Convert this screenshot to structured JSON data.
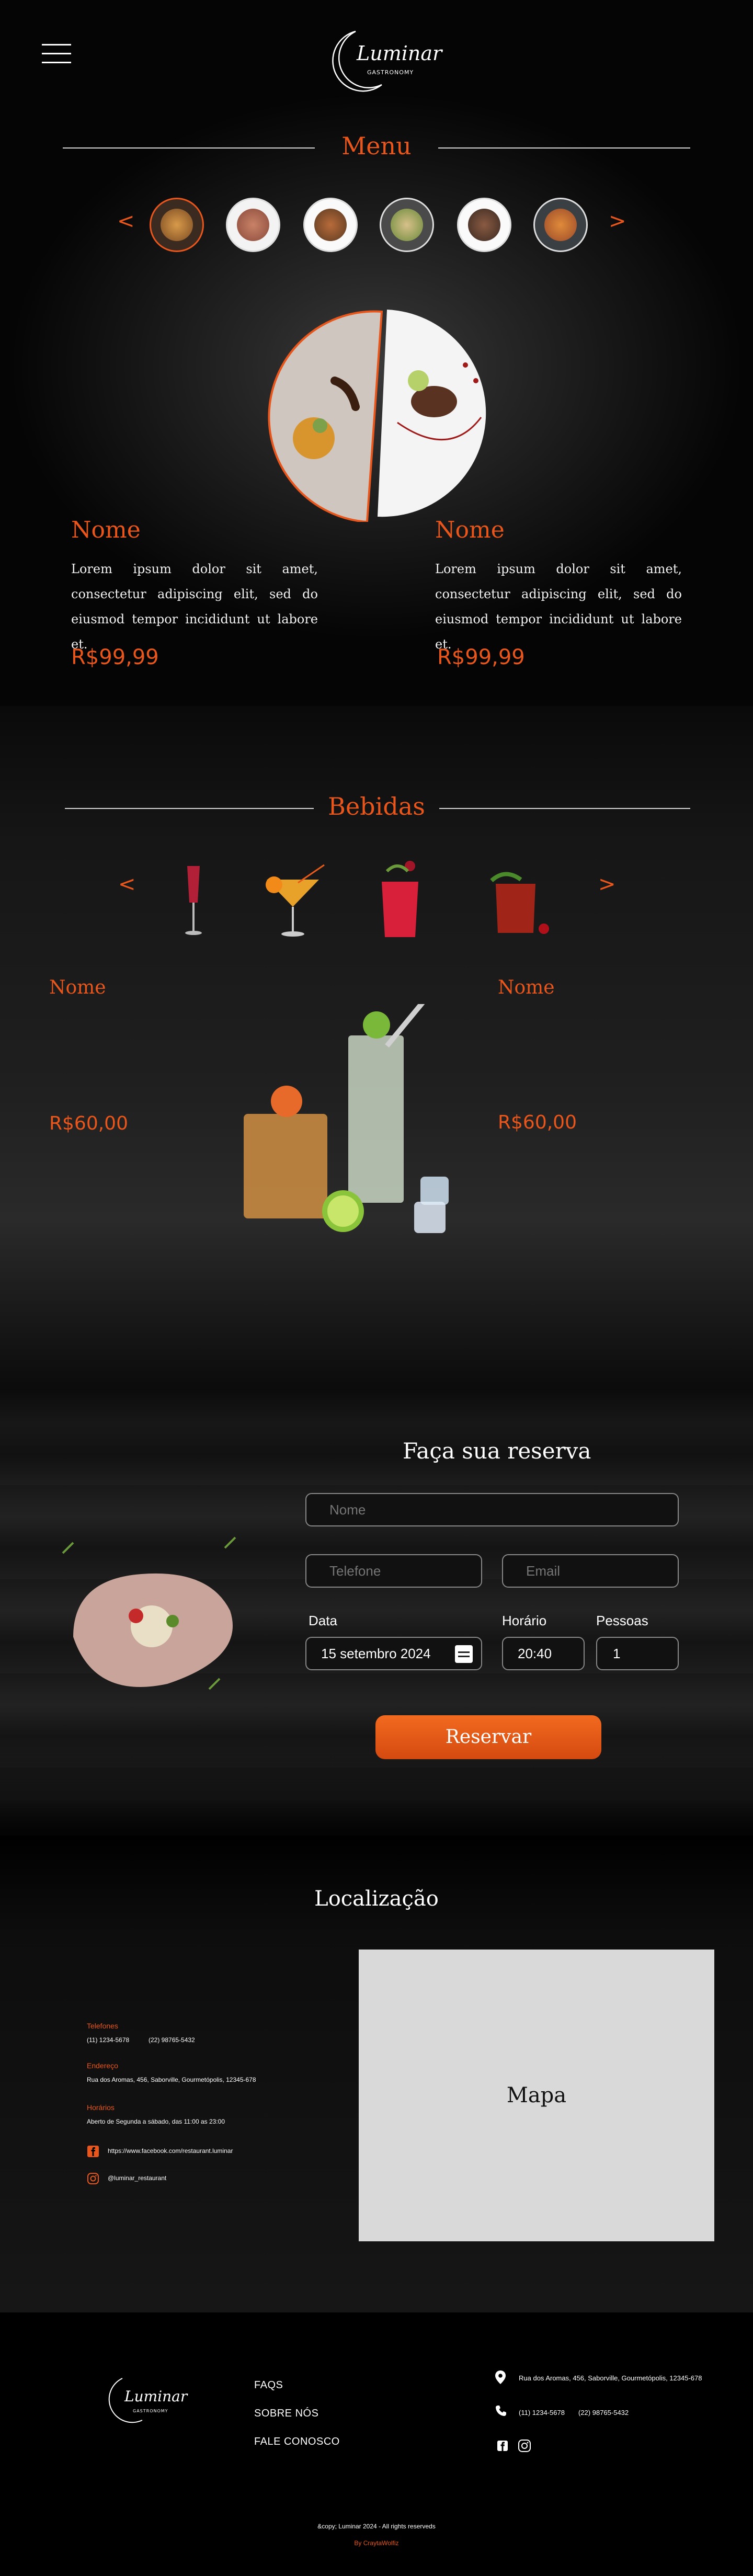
{
  "header": {
    "brand": "Luminar",
    "brand_sub": "GASTRONOMY"
  },
  "menu": {
    "title": "Menu",
    "prev": "<",
    "next": ">",
    "dishes": [
      {
        "name": "Nome",
        "description": "Lorem ipsum dolor sit amet, consectetur adipiscing elit, sed do eiusmod tempor incididunt ut labore et.",
        "price": "R$99,99"
      },
      {
        "name": "Nome",
        "description": "Lorem ipsum dolor sit amet, consectetur adipiscing elit, sed do eiusmod tempor incididunt ut labore et.",
        "price": "R$99,99"
      }
    ]
  },
  "drinks": {
    "title": "Bebidas",
    "prev": "<",
    "next": ">",
    "items": [
      {
        "name": "Nome",
        "price": "R$60,00"
      },
      {
        "name": "Nome",
        "price": "R$60,00"
      }
    ]
  },
  "reservation": {
    "title": "Faça sua reserva",
    "name_placeholder": "Nome",
    "phone_placeholder": "Telefone",
    "email_placeholder": "Email",
    "date_label": "Data",
    "date_value": "15 setembro 2024",
    "time_label": "Horário",
    "time_value": "20:40",
    "people_label": "Pessoas",
    "people_value": "1",
    "submit": "Reservar"
  },
  "location": {
    "title": "Localização",
    "phones_label": "Telefones",
    "phone_1": "(11) 1234-5678",
    "phone_2": "(22) 98765-5432",
    "address_label": "Endereço",
    "address": "Rua dos Aromas, 456, Saborville, Gourmetópolis, 12345-678",
    "hours_label": "Horários",
    "hours": "Aberto de Segunda a sábado, das 11:00 as 23:00",
    "facebook": "https://www.facebook.com/restaurant.luminar",
    "instagram": "@luminar_restaurant",
    "map_label": "Mapa"
  },
  "footer": {
    "links": [
      "FAQS",
      "SOBRE NÓS",
      "FALE CONOSCO"
    ],
    "address": "Rua dos Aromas, 456, Saborville, Gourmetópolis, 12345-678",
    "phone_1": "(11) 1234-5678",
    "phone_2": "(22) 98765-5432",
    "copyright": "&copy; Luminar 2024 - All rights reserveds",
    "credit": "By CraytaWolfiz"
  },
  "colors": {
    "accent": "#e8561c",
    "background": "#000000",
    "map": "#d9d9d9"
  }
}
